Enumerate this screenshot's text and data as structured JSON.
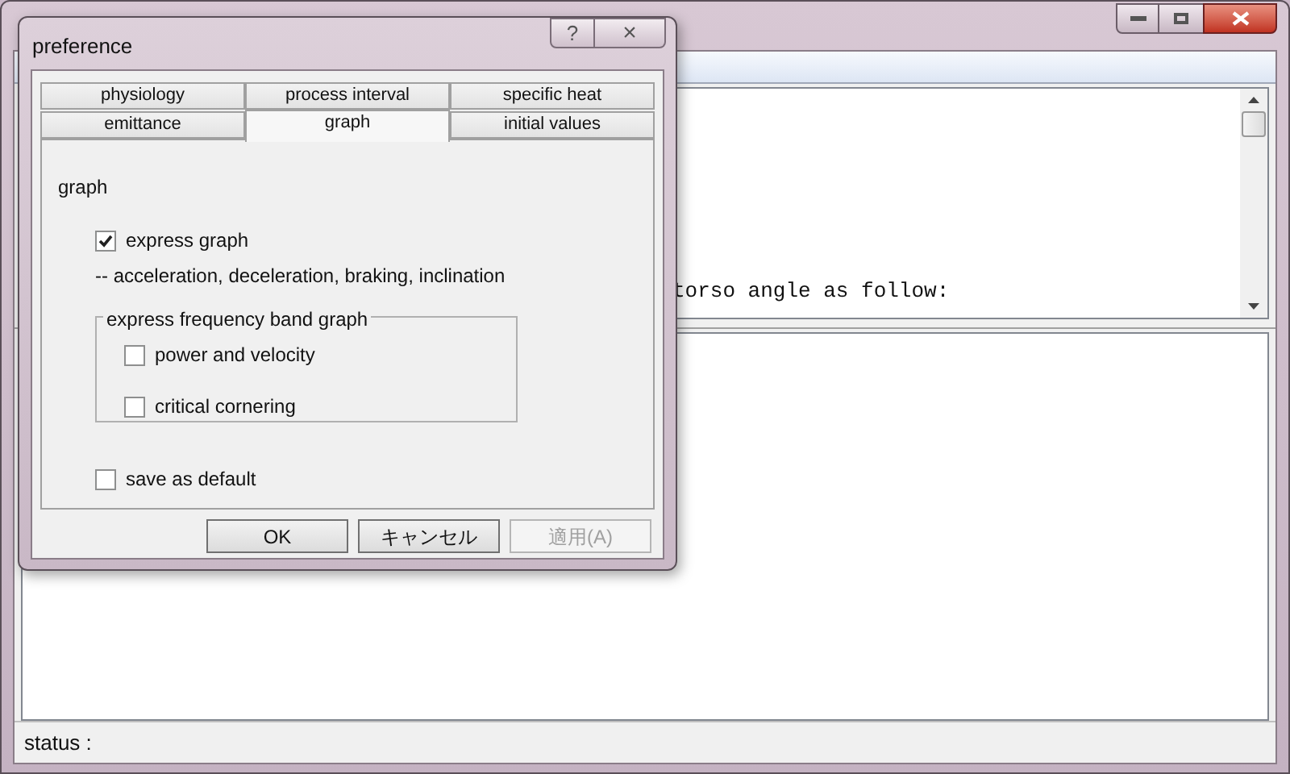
{
  "main_window": {
    "text_pane": {
      "line": "torso angle as follow:"
    },
    "status_bar": {
      "label": "status :"
    }
  },
  "dialog": {
    "title": "preference",
    "help_button": "?",
    "close_button": "×",
    "tab_rows": [
      [
        {
          "label": "physiology",
          "selected": false
        },
        {
          "label": "process interval",
          "selected": false
        },
        {
          "label": "specific heat",
          "selected": false
        }
      ],
      [
        {
          "label": "emittance",
          "selected": false
        },
        {
          "label": "graph",
          "selected": true
        },
        {
          "label": "initial values",
          "selected": false
        }
      ]
    ],
    "section_title": "graph",
    "express_graph": {
      "label": "express graph",
      "checked": true
    },
    "note": "-- acceleration, deceleration, braking, inclination",
    "group": {
      "title": "express frequency band graph",
      "options": [
        {
          "label": "power and velocity",
          "checked": false
        },
        {
          "label": "critical cornering",
          "checked": false
        }
      ]
    },
    "save_default": {
      "label": "save as default",
      "checked": false
    },
    "buttons": [
      {
        "label": "OK",
        "disabled": false
      },
      {
        "label": "キャンセル",
        "disabled": false
      },
      {
        "label": "適用(A)",
        "disabled": true
      }
    ]
  }
}
